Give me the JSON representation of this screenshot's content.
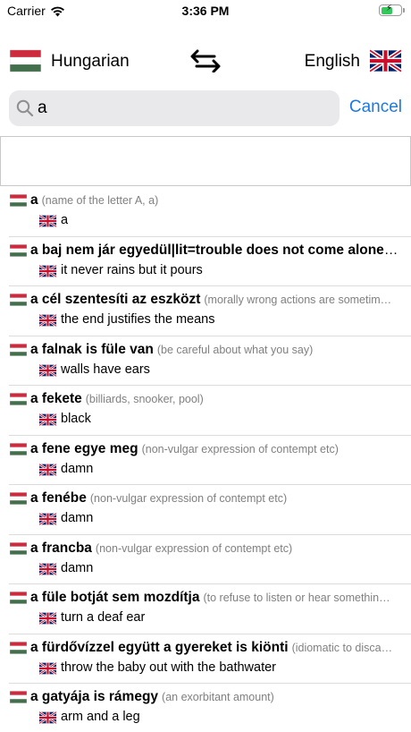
{
  "status_bar": {
    "carrier": "Carrier",
    "time": "3:36 PM",
    "wifi_icon": "wifi-icon",
    "battery_icon": "battery-charging-icon",
    "battery_level": 0.6
  },
  "header": {
    "from_language": "Hungarian",
    "to_language": "English",
    "swap_icon": "swap-arrows-icon"
  },
  "search": {
    "value": "a",
    "cancel_label": "Cancel"
  },
  "colors": {
    "accent": "#1a7ae5",
    "note_gray": "#808080",
    "search_bg": "#e9e9eb"
  },
  "entries": [
    {
      "term": "a",
      "note": "(name of the letter A, a)",
      "translation": "a"
    },
    {
      "term": "a baj nem jár egyedül|lit=trouble does not come alone…",
      "note": "",
      "translation": "it never rains but it pours"
    },
    {
      "term": "a cél szentesíti az eszközt",
      "note": "(morally wrong actions are sometim…",
      "translation": "the end justifies the means"
    },
    {
      "term": "a falnak is füle van",
      "note": "(be careful about what you say)",
      "translation": "walls have ears"
    },
    {
      "term": "a fekete",
      "note": "(billiards, snooker, pool)",
      "translation": "black"
    },
    {
      "term": "a fene egye meg",
      "note": "(non-vulgar expression of contempt etc)",
      "translation": "damn"
    },
    {
      "term": "a fenébe",
      "note": "(non-vulgar expression of contempt etc)",
      "translation": "damn"
    },
    {
      "term": "a francba",
      "note": "(non-vulgar expression of contempt etc)",
      "translation": "damn"
    },
    {
      "term": "a füle botját sem mozdítja",
      "note": "(to refuse to listen or hear somethin…",
      "translation": "turn a deaf ear"
    },
    {
      "term": "a fürdővízzel együtt a gyereket is kiönti",
      "note": "(idiomatic to disca…",
      "translation": "throw the baby out with the bathwater"
    },
    {
      "term": "a gatyája is rámegy",
      "note": "(an exorbitant amount)",
      "translation": "arm and a leg"
    }
  ]
}
